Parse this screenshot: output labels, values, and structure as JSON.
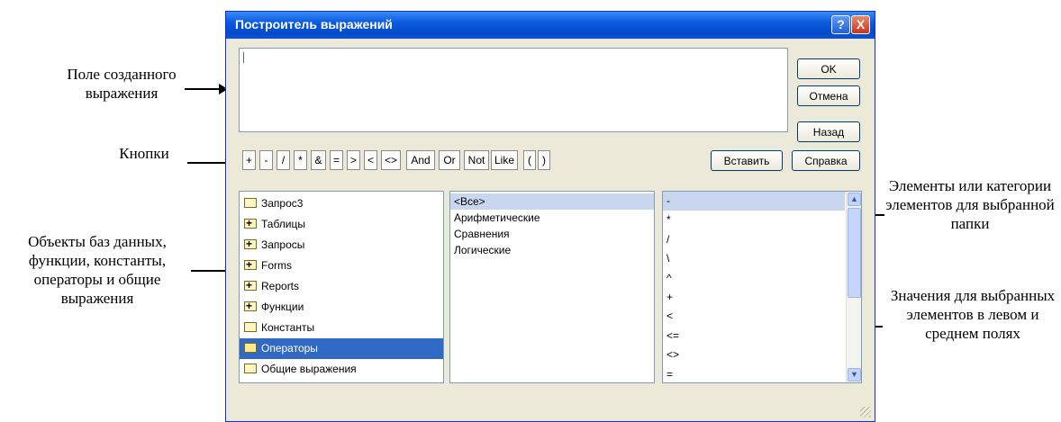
{
  "annotations": {
    "expr_field": "Поле созданного выражения",
    "buttons": "Кнопки",
    "objects": "Объекты баз данных, функции, константы, операторы и общие выражения",
    "elements": "Элементы или категории элементов для выбранной папки",
    "values": "Значения для выбранных элементов в левом и среднем полях"
  },
  "dialog": {
    "title": "Построитель выражений",
    "help_glyph": "?",
    "close_glyph": "X",
    "ok": "OK",
    "cancel": "Отмена",
    "back": "Назад",
    "insert": "Вставить",
    "help": "Справка"
  },
  "operators": [
    "+",
    "-",
    "/",
    "*",
    "&",
    "=",
    ">",
    "<",
    "<>",
    "And",
    "Or",
    "Not",
    "Like",
    "(",
    ")"
  ],
  "folders": [
    {
      "label": "Запрос3",
      "icon": "folder-icon"
    },
    {
      "label": "Таблицы",
      "icon": "folder-plus-icon"
    },
    {
      "label": "Запросы",
      "icon": "folder-plus-icon"
    },
    {
      "label": "Forms",
      "icon": "folder-plus-icon"
    },
    {
      "label": "Reports",
      "icon": "folder-plus-icon"
    },
    {
      "label": "Функции",
      "icon": "folder-plus-icon"
    },
    {
      "label": "Константы",
      "icon": "folder-icon"
    },
    {
      "label": "Операторы",
      "icon": "folder-open-icon",
      "selected": true
    },
    {
      "label": "Общие выражения",
      "icon": "folder-icon"
    }
  ],
  "categories": [
    "<Все>",
    "Арифметические",
    "Сравнения",
    "Логические"
  ],
  "values": [
    "-",
    "*",
    "/",
    "\\",
    "^",
    "+",
    "<",
    "<=",
    "<>",
    "=",
    ">"
  ]
}
